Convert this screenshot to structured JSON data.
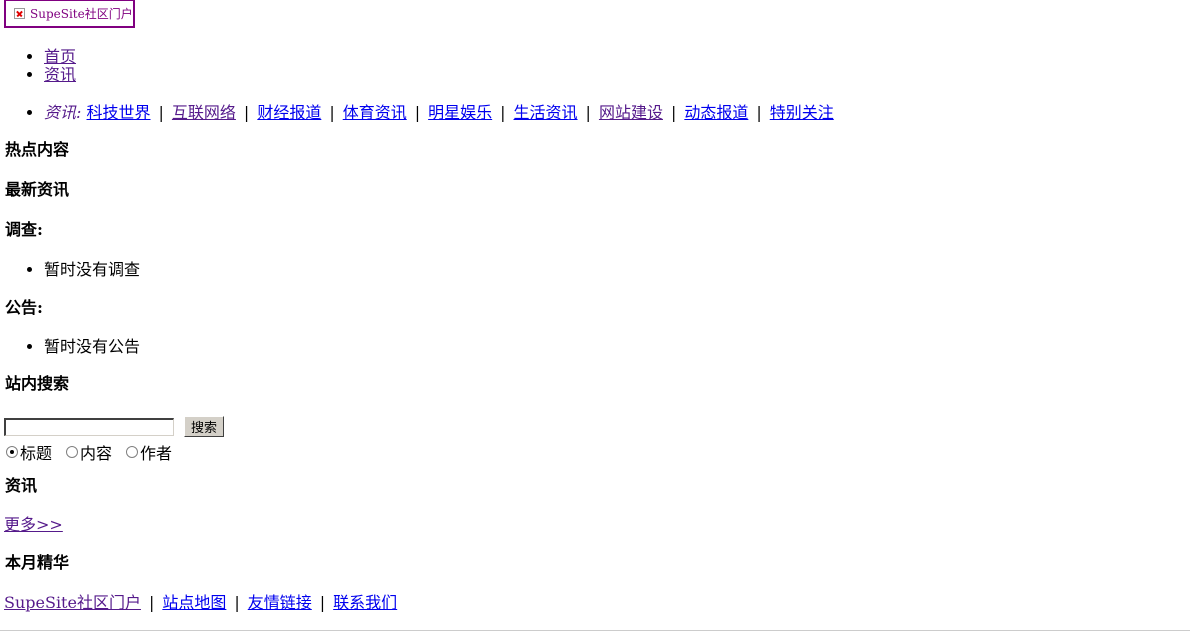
{
  "header": {
    "logo_alt": "SupeSite社区门户"
  },
  "main_menu": {
    "items": [
      "首页",
      "资讯"
    ]
  },
  "sub_nav": {
    "current_label": "资讯:",
    "items": [
      "科技世界",
      "互联网络",
      "财经报道",
      "体育资讯",
      "明星娱乐",
      "生活资讯",
      "网站建设",
      "动态报道",
      "特别关注"
    ],
    "separator": "|"
  },
  "sections": {
    "hot": "热点内容",
    "latest": "最新资讯",
    "poll_title": "调查:",
    "poll_empty": "暂时没有调查",
    "notice_title": "公告:",
    "notice_empty": "暂时没有公告",
    "search_title": "站内搜索",
    "news_title": "资讯",
    "more_link": "更多>>",
    "monthly_title": "本月精华"
  },
  "search": {
    "input_value": "",
    "button_label": "搜索",
    "options": [
      "标题",
      "内容",
      "作者"
    ],
    "selected": "标题"
  },
  "footer": {
    "links": [
      "SupeSite社区门户",
      "站点地图",
      "友情链接",
      "联系我们"
    ],
    "separator": "|"
  },
  "colors": {
    "link": "#0000ee",
    "visited_link": "#551a8b",
    "logo_border": "#800080"
  }
}
